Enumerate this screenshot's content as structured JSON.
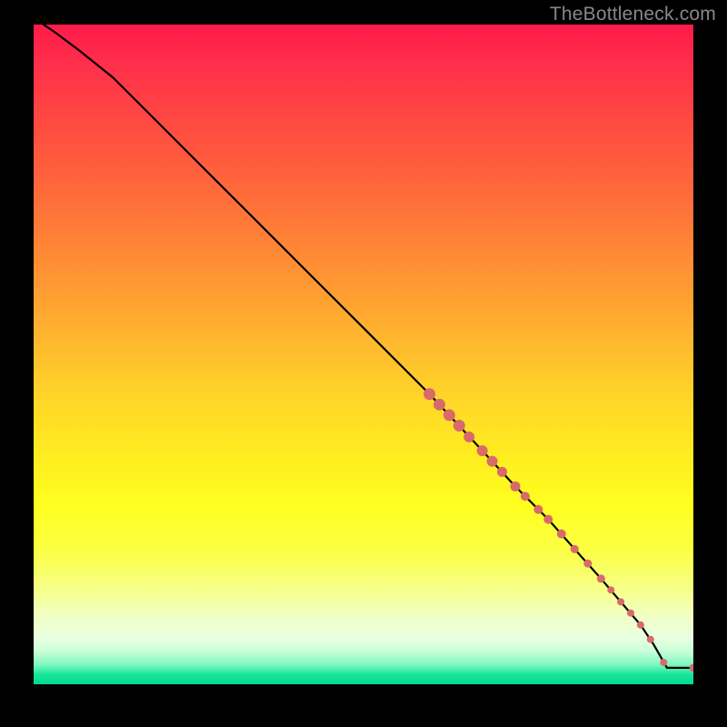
{
  "watermark": "TheBottleneck.com",
  "chart_data": {
    "type": "line",
    "title": "",
    "xlabel": "",
    "ylabel": "",
    "xlim": [
      0,
      100
    ],
    "ylim": [
      0,
      100
    ],
    "grid": false,
    "series": [
      {
        "name": "curve",
        "x": [
          0,
          3,
          7,
          12,
          18,
          25,
          33,
          42,
          51,
          60,
          67,
          73,
          78,
          82,
          86,
          89,
          92,
          94,
          96,
          100
        ],
        "y": [
          101,
          99,
          96,
          92,
          86,
          79,
          71,
          62,
          53,
          44,
          36.5,
          30,
          25,
          20.5,
          16,
          12.5,
          9,
          6,
          2.5,
          2.5
        ]
      }
    ],
    "markers": {
      "name": "highlight-points",
      "color": "#d86a6a",
      "points": [
        {
          "x": 60.0,
          "y": 44.0,
          "r": 6.5
        },
        {
          "x": 61.5,
          "y": 42.4,
          "r": 6.5
        },
        {
          "x": 63.0,
          "y": 40.8,
          "r": 6.5
        },
        {
          "x": 64.5,
          "y": 39.2,
          "r": 6.5
        },
        {
          "x": 66.0,
          "y": 37.5,
          "r": 6.0
        },
        {
          "x": 68.0,
          "y": 35.4,
          "r": 6.0
        },
        {
          "x": 69.5,
          "y": 33.8,
          "r": 6.0
        },
        {
          "x": 71.0,
          "y": 32.2,
          "r": 5.5
        },
        {
          "x": 73.0,
          "y": 30.0,
          "r": 5.5
        },
        {
          "x": 74.5,
          "y": 28.5,
          "r": 5.0
        },
        {
          "x": 76.5,
          "y": 26.5,
          "r": 5.0
        },
        {
          "x": 78.0,
          "y": 25.0,
          "r": 5.0
        },
        {
          "x": 80.0,
          "y": 22.8,
          "r": 5.0
        },
        {
          "x": 82.0,
          "y": 20.5,
          "r": 4.5
        },
        {
          "x": 84.0,
          "y": 18.3,
          "r": 4.5
        },
        {
          "x": 86.0,
          "y": 16.0,
          "r": 4.5
        },
        {
          "x": 87.5,
          "y": 14.3,
          "r": 4.0
        },
        {
          "x": 89.0,
          "y": 12.5,
          "r": 4.0
        },
        {
          "x": 90.5,
          "y": 10.8,
          "r": 4.0
        },
        {
          "x": 92.0,
          "y": 9.0,
          "r": 4.0
        },
        {
          "x": 93.5,
          "y": 6.8,
          "r": 4.0
        },
        {
          "x": 95.5,
          "y": 3.3,
          "r": 4.0
        },
        {
          "x": 100.0,
          "y": 2.5,
          "r": 4.5
        }
      ]
    },
    "background": {
      "type": "vertical-gradient",
      "stops": [
        {
          "pos": 0.0,
          "color": "#ff1a4a"
        },
        {
          "pos": 0.5,
          "color": "#ffca28"
        },
        {
          "pos": 0.8,
          "color": "#f9ff50"
        },
        {
          "pos": 1.0,
          "color": "#00d98e"
        }
      ]
    }
  }
}
